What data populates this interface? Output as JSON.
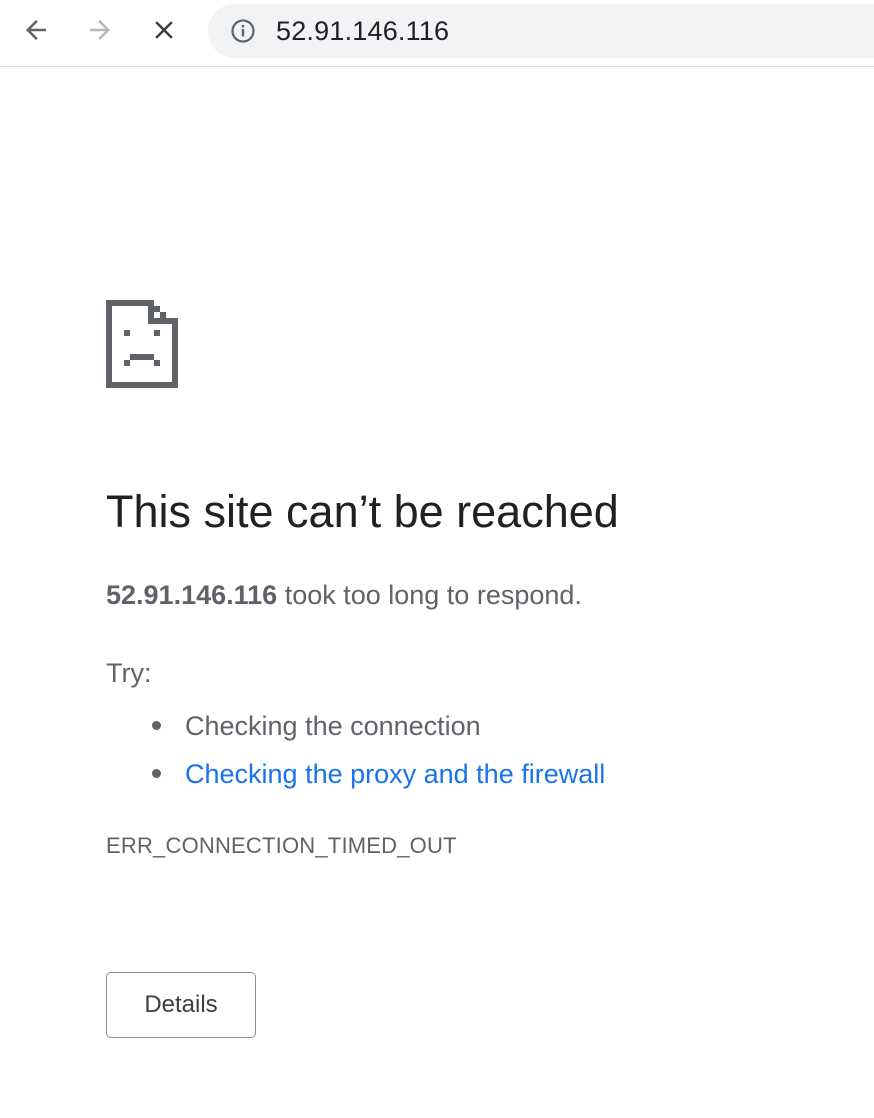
{
  "browser": {
    "nav": {
      "back_icon": "arrow-left-icon",
      "forward_icon": "arrow-right-icon",
      "stop_icon": "close-icon"
    },
    "omnibox": {
      "info_icon": "info-circle-icon",
      "url": "52.91.146.116"
    }
  },
  "error_page": {
    "icon": "sad-page-icon",
    "heading": "This site can’t be reached",
    "host": "52.91.146.116",
    "message_suffix": " took too long to respond.",
    "try_label": "Try:",
    "suggestions": [
      {
        "text": "Checking the connection",
        "link": false
      },
      {
        "text": "Checking the proxy and the firewall",
        "link": true
      }
    ],
    "error_code": "ERR_CONNECTION_TIMED_OUT",
    "details_label": "Details"
  },
  "colors": {
    "heading": "#202124",
    "body_text": "#5f6368",
    "link": "#1a73e8",
    "omnibox_bg": "#f1f3f4"
  }
}
